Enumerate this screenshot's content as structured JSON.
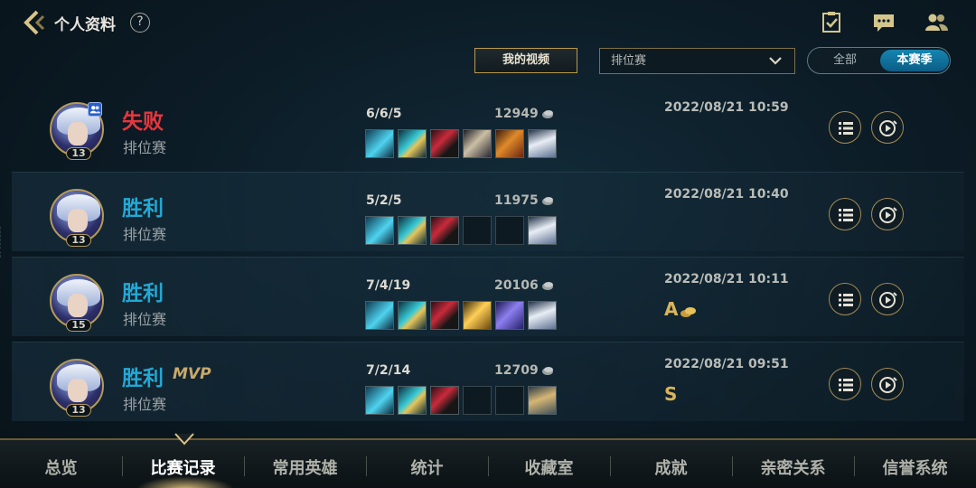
{
  "header": {
    "title": "个人资料",
    "help": "?"
  },
  "filters": {
    "video_button": "我的视频",
    "mode_selected": "排位赛",
    "season_all": "全部",
    "season_current": "本赛季"
  },
  "matches": [
    {
      "result": "失败",
      "result_type": "lose",
      "mvp": "",
      "mode": "排位赛",
      "level": "13",
      "kda": "6/6/5",
      "gold": "12949",
      "date": "2022/08/21 10:59",
      "grade": "",
      "items": [
        "sk1",
        "sk2",
        "sword",
        "spear",
        "hammer",
        "boots"
      ]
    },
    {
      "result": "胜利",
      "result_type": "win",
      "mvp": "",
      "mode": "排位赛",
      "level": "13",
      "kda": "5/2/5",
      "gold": "11975",
      "date": "2022/08/21 10:40",
      "grade": "",
      "items": [
        "sk1",
        "sk2",
        "sword",
        "empty",
        "empty",
        "boots"
      ]
    },
    {
      "result": "胜利",
      "result_type": "win",
      "mvp": "",
      "mode": "排位赛",
      "level": "15",
      "kda": "7/4/19",
      "gold": "20106",
      "date": "2022/08/21 10:11",
      "grade": "A",
      "items": [
        "sk1",
        "sk2",
        "sword",
        "golden",
        "lance",
        "boots"
      ]
    },
    {
      "result": "胜利",
      "result_type": "win",
      "mvp": "MVP",
      "mode": "排位赛",
      "level": "13",
      "kda": "7/2/14",
      "gold": "12709",
      "date": "2022/08/21 09:51",
      "grade": "S",
      "items": [
        "sk1",
        "sk2",
        "sword",
        "empty",
        "empty",
        "armor"
      ]
    }
  ],
  "nav": {
    "items": [
      "总览",
      "比赛记录",
      "常用英雄",
      "统计",
      "收藏室",
      "成就",
      "亲密关系",
      "信誉系统"
    ],
    "active_index": 1
  },
  "side_code": "03920147",
  "colors": {
    "lose": "#e8363d",
    "win": "#21a9d6",
    "gold_accent": "#b9994f",
    "season_active": "#1585b0"
  }
}
